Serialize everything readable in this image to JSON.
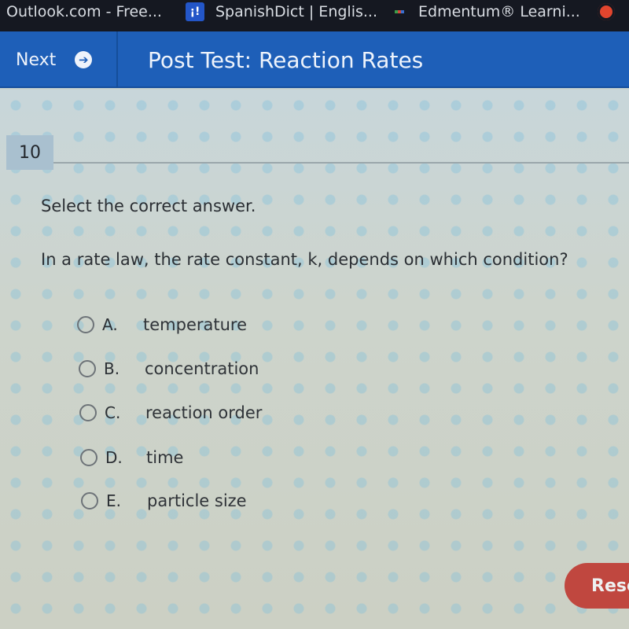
{
  "bookmarks": [
    {
      "label": "Outlook.com - Free...",
      "icon": "none"
    },
    {
      "label": "SpanishDict | Englis...",
      "icon": "spanishdict-icon",
      "icon_glyph": "¡!"
    },
    {
      "label": "Edmentum® Learni...",
      "icon": "edmentum-icon"
    },
    {
      "label": "",
      "icon": "extension-icon"
    }
  ],
  "header": {
    "next_label": "Next",
    "next_icon": "➔",
    "title": "Post Test: Reaction Rates"
  },
  "question": {
    "number": "10",
    "instruction": "Select the correct answer.",
    "prompt": "In a rate law, the rate constant, k, depends on which condition?",
    "options": [
      {
        "letter": "A.",
        "text": "temperature",
        "selected": false
      },
      {
        "letter": "B.",
        "text": "concentration",
        "selected": false
      },
      {
        "letter": "C.",
        "text": "reaction order",
        "selected": false
      },
      {
        "letter": "D.",
        "text": "time",
        "selected": false
      },
      {
        "letter": "E.",
        "text": "particle size",
        "selected": false
      }
    ]
  },
  "footer": {
    "reset_label": "Reset"
  },
  "colors": {
    "header_blue": "#1e5fb8",
    "reset_red": "#c0473f",
    "bookmarks_bg": "#151821"
  }
}
